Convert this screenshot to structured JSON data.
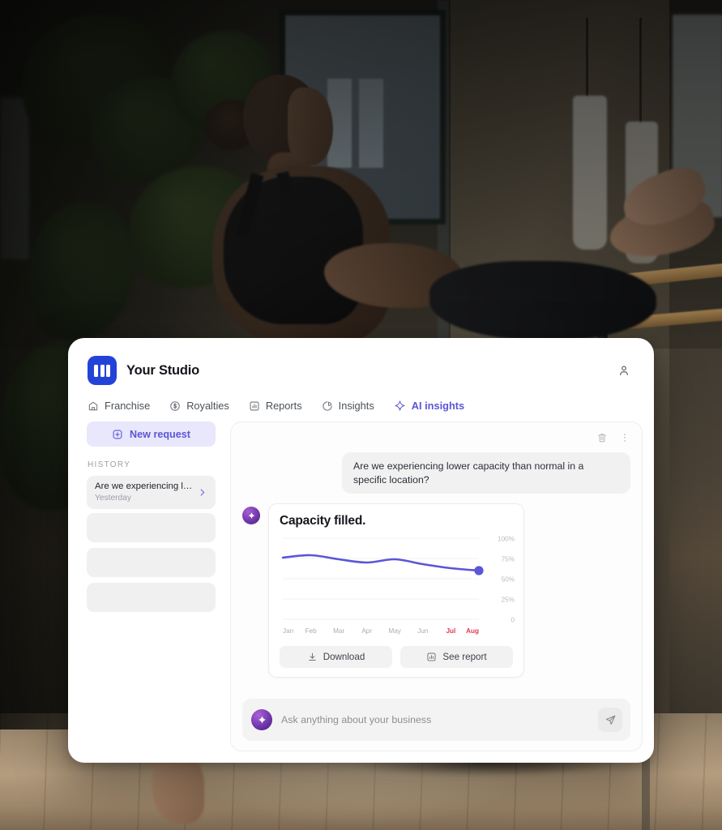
{
  "app": {
    "brand_name": "Your Studio",
    "logo_icon": "studio-logo-icon",
    "profile_icon": "user-icon"
  },
  "nav": {
    "tabs": [
      {
        "label": "Franchise",
        "icon": "store-icon",
        "active": false
      },
      {
        "label": "Royalties",
        "icon": "dollar-circle-icon",
        "active": false
      },
      {
        "label": "Reports",
        "icon": "bar-chart-square-icon",
        "active": false
      },
      {
        "label": "Insights",
        "icon": "pie-chart-icon",
        "active": false
      },
      {
        "label": "AI insights",
        "icon": "sparkle-icon",
        "active": true
      }
    ]
  },
  "sidebar": {
    "new_request_label": "New request",
    "new_request_icon": "plus-square-icon",
    "history_heading": "HISTORY",
    "history": [
      {
        "title": "Are we experiencing lowe...",
        "subtitle": "Yesterday",
        "chevron": "chevron-right-icon"
      }
    ],
    "placeholder_rows": 3
  },
  "chat": {
    "tools": [
      {
        "name": "delete-conversation",
        "icon": "trash-icon"
      },
      {
        "name": "more-options",
        "icon": "more-vertical-icon"
      }
    ],
    "user_message": "Are we experiencing lower capacity than normal in a specific location?",
    "ai_avatar_icon": "sparkle-icon",
    "card": {
      "title": "Capacity filled.",
      "actions": [
        {
          "label": "Download",
          "icon": "download-icon"
        },
        {
          "label": "See report",
          "icon": "bar-chart-icon"
        }
      ]
    },
    "composer": {
      "avatar_icon": "sparkle-icon",
      "placeholder": "Ask anything about your business",
      "value": "",
      "send_icon": "send-icon"
    }
  },
  "colors": {
    "brand_blue": "#2343d8",
    "accent_purple": "#5b56d6",
    "chart_line": "#5b56d6",
    "alert_red": "#e23b4e",
    "muted_text": "#9aa0a6"
  },
  "chart_data": {
    "type": "line",
    "title": "Capacity filled.",
    "categories": [
      "Jan",
      "Feb",
      "Mar",
      "Apr",
      "May",
      "Jun",
      "Jul",
      "Aug"
    ],
    "values": [
      76,
      79,
      74,
      70,
      74,
      68,
      63,
      60
    ],
    "series": [
      {
        "name": "Capacity filled",
        "values": [
          76,
          79,
          74,
          70,
          74,
          68,
          63,
          60
        ]
      }
    ],
    "ytick_labels": [
      "100%",
      "75%",
      "50%",
      "25%",
      "0"
    ],
    "ytick_values": [
      100,
      75,
      50,
      25,
      0
    ],
    "ylim": [
      0,
      100
    ],
    "xlabel": "",
    "ylabel": "",
    "grid": true,
    "legend": "none",
    "highlighted_categories": [
      "Jul",
      "Aug"
    ],
    "highlight_color": "#e23b4e",
    "endpoint_marker": {
      "category": "Aug",
      "value": 60
    },
    "line_color": "#5b56d6"
  }
}
